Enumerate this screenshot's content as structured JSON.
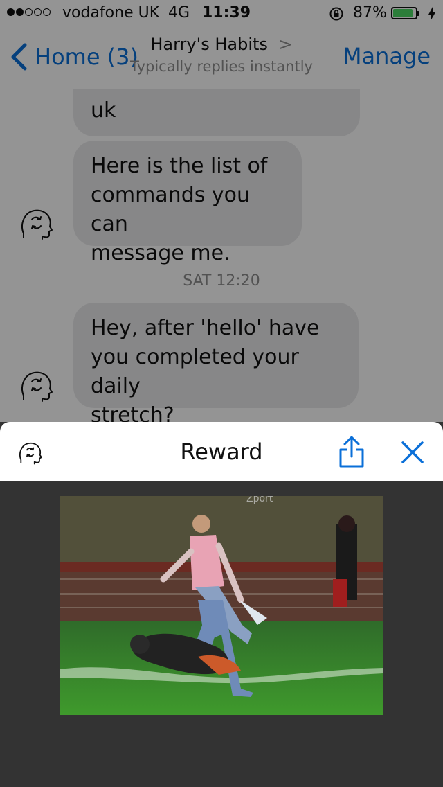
{
  "status_bar": {
    "carrier": "vodafone UK",
    "network": "4G",
    "time": "11:39",
    "battery_percent": "87%",
    "battery_level": 0.87,
    "signal_bars": 2,
    "colors": {
      "battery_fill": "#4cd964"
    }
  },
  "nav": {
    "back_label": "Home (3)",
    "title": "Harry's Habits",
    "title_chevron": ">",
    "subtitle": "Typically replies instantly",
    "manage_label": "Manage",
    "accent": "#0a6fd8"
  },
  "messages": [
    {
      "text": "uk",
      "sender": "bot"
    },
    {
      "text": "Here is the list of commands you can message me.",
      "lines": [
        "Here is the list of",
        "commands you can",
        "message me."
      ],
      "sender": "bot"
    },
    {
      "type": "timestamp",
      "text": "SAT 12:20"
    },
    {
      "text": "Hey, after 'hello' have you completed your daily stretch?",
      "lines": [
        "Hey, after 'hello' have",
        "you completed your daily",
        "stretch?"
      ],
      "sender": "bot"
    }
  ],
  "sheet": {
    "title": "Reward",
    "icons": {
      "avatar": "head-gears-icon",
      "share": "share-icon",
      "close": "close-icon"
    },
    "image_description_icon": "reward-gif-image"
  }
}
